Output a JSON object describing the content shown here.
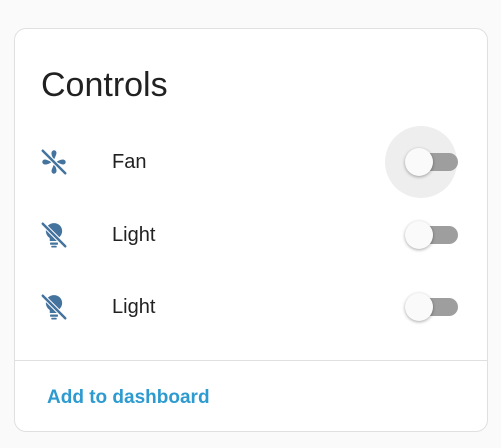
{
  "card": {
    "title": "Controls",
    "rows": [
      {
        "label": "Fan",
        "icon": "fan-off-icon",
        "state": "off"
      },
      {
        "label": "Light",
        "icon": "lightbulb-off-icon",
        "state": "off"
      },
      {
        "label": "Light",
        "icon": "lightbulb-off-icon",
        "state": "off"
      }
    ],
    "action_label": "Add to dashboard"
  },
  "colors": {
    "icon": "#44739e",
    "accent": "#2e9bd0",
    "toggle_track_off": "#9e9e9e",
    "toggle_thumb": "#fafafa",
    "text": "#212121"
  }
}
